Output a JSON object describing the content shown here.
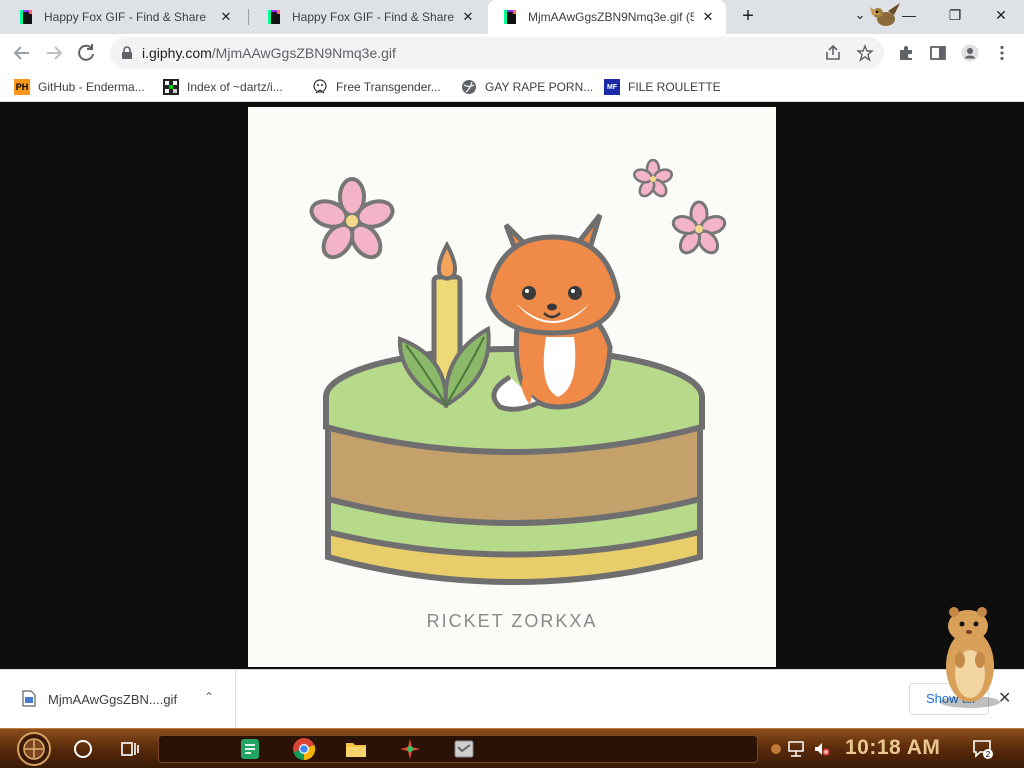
{
  "tabs": [
    {
      "title": "Happy Fox GIF - Find & Share",
      "active": false
    },
    {
      "title": "Happy Fox GIF - Find & Share",
      "active": false
    },
    {
      "title": "MjmAAwGgsZBN9Nmq3e.gif (5",
      "active": true
    }
  ],
  "tab_controls": {
    "new_tab": "+",
    "close": "✕",
    "tab_search": "⌄"
  },
  "window_controls": {
    "minimize": "—",
    "restore": "❐",
    "close": "✕"
  },
  "omnibox": {
    "host": "i.giphy.com",
    "path": "/MjmAAwGgsZBN9Nmq3e.gif"
  },
  "bookmarks": [
    {
      "label": "GitHub - Enderma...",
      "icon_text": "PH"
    },
    {
      "label": "Index of ~dartz/i...",
      "icon_text": ""
    },
    {
      "label": "Free Transgender...",
      "icon_text": ""
    },
    {
      "label": "GAY RAPE PORN...",
      "icon_text": ""
    },
    {
      "label": "FILE ROULETTE",
      "icon_text": "MF"
    }
  ],
  "gif": {
    "watermark": "RICKET ZORKXA"
  },
  "download_shelf": {
    "filename": "MjmAAwGgsZBN....gif",
    "show_all": "Show all",
    "caret": "⌃",
    "close": "✕"
  },
  "taskbar": {
    "clock": "10:18 AM",
    "notification_count": "2"
  },
  "colors": {
    "tab_strip": "#dee1e6",
    "accent": "#1a73e8",
    "taskbar": "#5a2a0a",
    "clock": "#e9c890"
  }
}
